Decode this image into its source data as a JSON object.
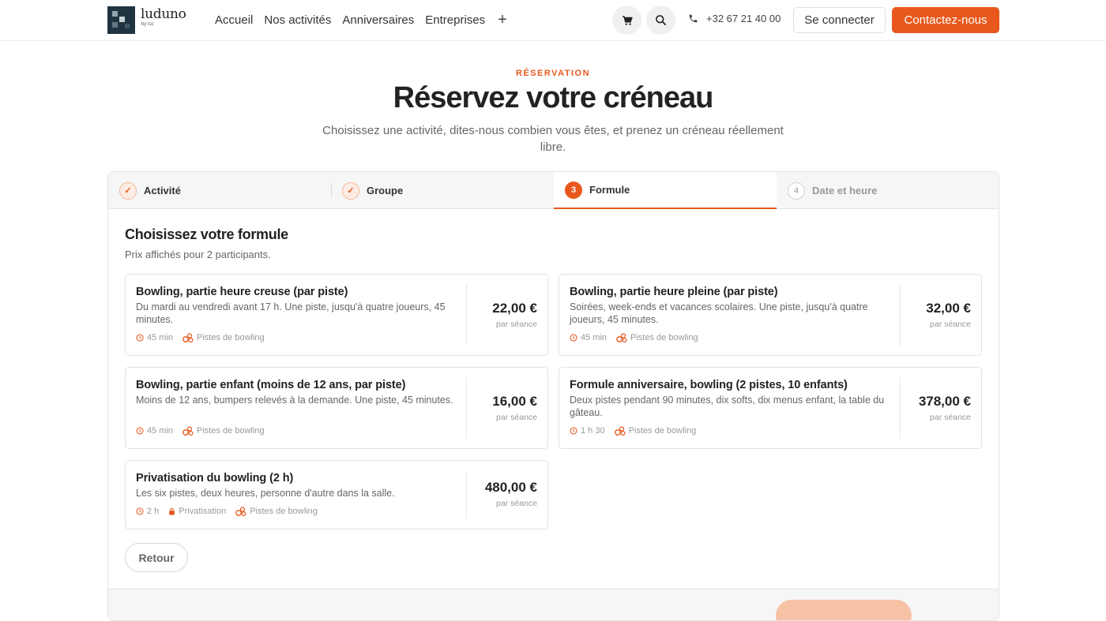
{
  "brand": {
    "name": "luduno",
    "sub": "by tsc"
  },
  "nav": {
    "items": [
      "Accueil",
      "Nos activités",
      "Anniversaires",
      "Entreprises"
    ],
    "more": "+"
  },
  "header": {
    "cart_icon": "cart-icon",
    "search_icon": "search-icon",
    "phone": "+32 67 21 40 00",
    "login_label": "Se connecter",
    "contact_label": "Contactez-nous",
    "accent_color": "#e8581d"
  },
  "hero": {
    "eyebrow": "RÉSERVATION",
    "title": "Réservez votre créneau",
    "subtitle": "Choisissez une activité, dites-nous combien vous êtes, et prenez un créneau réellement libre."
  },
  "steps": [
    {
      "number": "✓",
      "label": "Activité",
      "state": "done"
    },
    {
      "number": "✓",
      "label": "Groupe",
      "state": "done"
    },
    {
      "number": "3",
      "label": "Formule",
      "state": "active"
    },
    {
      "number": "4",
      "label": "Date et heure",
      "state": "todo"
    }
  ],
  "section": {
    "title": "Choisissez votre formule",
    "subtitle": "Prix affichés pour 2 participants."
  },
  "formulas": [
    {
      "name": "Bowling, partie heure creuse (par piste)",
      "desc": "Du mardi au vendredi avant 17 h. Une piste, jusqu'à quatre joueurs, 45 minutes.",
      "duration": "45 min",
      "place": "Pistes de bowling",
      "price": "22,00 €",
      "per": "par séance"
    },
    {
      "name": "Bowling, partie heure pleine (par piste)",
      "desc": "Soirées, week-ends et vacances scolaires. Une piste, jusqu'à quatre joueurs, 45 minutes.",
      "duration": "45 min",
      "place": "Pistes de bowling",
      "price": "32,00 €",
      "per": "par séance"
    },
    {
      "name": "Bowling, partie enfant (moins de 12 ans, par piste)",
      "desc": "Moins de 12 ans, bumpers relevés à la demande. Une piste, 45 minutes.",
      "duration": "45 min",
      "place": "Pistes de bowling",
      "price": "16,00 €",
      "per": "par séance"
    },
    {
      "name": "Formule anniversaire, bowling (2 pistes, 10 enfants)",
      "desc": "Deux pistes pendant 90 minutes, dix softs, dix menus enfant, la table du gâteau.",
      "duration": "1 h 30",
      "place": "Pistes de bowling",
      "price": "378,00 €",
      "per": "par séance"
    },
    {
      "name": "Privatisation du bowling (2 h)",
      "desc": "Les six pistes, deux heures, personne d'autre dans la salle.",
      "duration": "2 h",
      "private": "Privatisation",
      "place": "Pistes de bowling",
      "price": "480,00 €",
      "per": "par séance"
    }
  ],
  "actions": {
    "back_label": "Retour"
  }
}
